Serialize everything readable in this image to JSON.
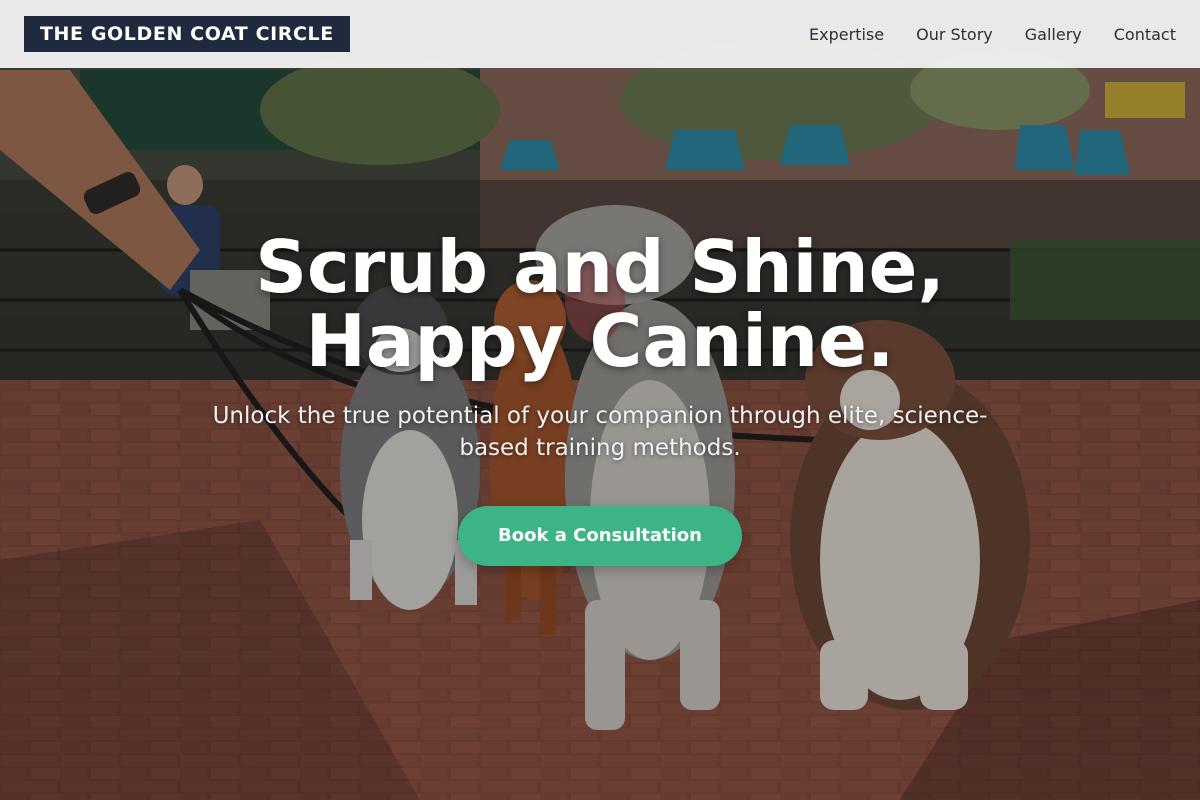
{
  "header": {
    "brand": "THE GOLDEN COAT CIRCLE",
    "nav": [
      {
        "label": "Expertise"
      },
      {
        "label": "Our Story"
      },
      {
        "label": "Gallery"
      },
      {
        "label": "Contact"
      }
    ]
  },
  "hero": {
    "headline_line1": "Scrub and Shine,",
    "headline_line2": "Happy Canine.",
    "subheadline": "Unlock the true potential of your companion through elite, science-based training methods.",
    "cta_label": "Book a Consultation",
    "background_image": "dogs-on-leashes-brick-plaza-photo"
  },
  "colors": {
    "brand_bg": "#1f2a3f",
    "cta": "#3db485",
    "header_bg": "#f0f0f0"
  }
}
